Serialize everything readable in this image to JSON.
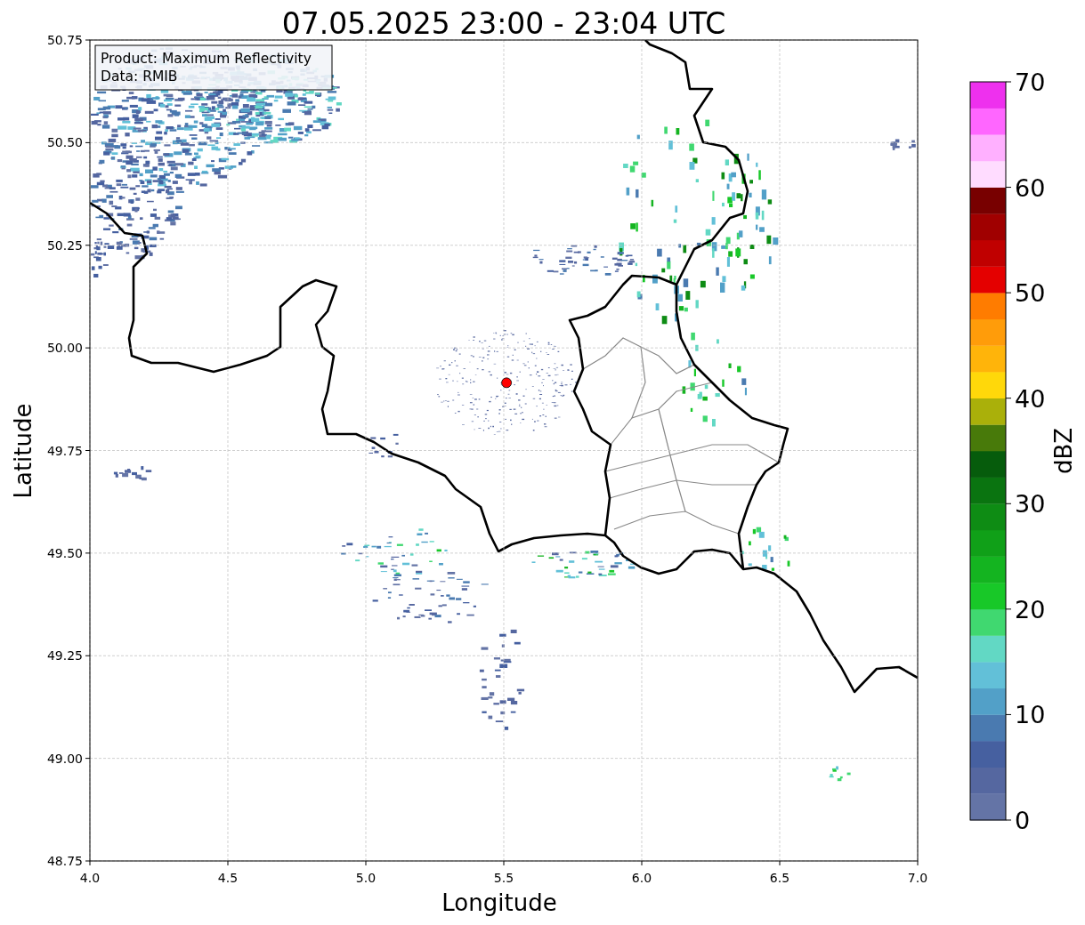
{
  "chart": {
    "chart_data": {
      "type": "scatter",
      "title": "07.05.2025 23:00 - 23:04 UTC",
      "xlabel": "Longitude",
      "ylabel": "Latitude",
      "xlim": [
        4,
        7
      ],
      "ylim": [
        48.75,
        50.75
      ],
      "xticks": [
        {
          "value": 4,
          "label": "4.0"
        },
        {
          "value": 4.5,
          "label": "4.5"
        },
        {
          "value": 5,
          "label": "5.0"
        },
        {
          "value": 5.5,
          "label": "5.5"
        },
        {
          "value": 6,
          "label": "6.0"
        },
        {
          "value": 6.5,
          "label": "6.5"
        },
        {
          "value": 7,
          "label": "7.0"
        }
      ],
      "yticks": [
        {
          "value": 48.75,
          "label": "48.75"
        },
        {
          "value": 49,
          "label": "49.00"
        },
        {
          "value": 49.25,
          "label": "49.25"
        },
        {
          "value": 49.5,
          "label": "49.50"
        },
        {
          "value": 49.75,
          "label": "49.75"
        },
        {
          "value": 50,
          "label": "50.00"
        },
        {
          "value": 50.25,
          "label": "50.25"
        },
        {
          "value": 50.5,
          "label": "50.50"
        },
        {
          "value": 50.75,
          "label": "50.75"
        }
      ],
      "grid": true,
      "x": [
        5.51
      ],
      "series": [
        {
          "color": "#ff0000",
          "values": [
            49.915
          ]
        }
      ]
    },
    "info_box": [
      "Product: Maximum Reflectivity",
      "Data: RMIB"
    ]
  },
  "colorbar": {
    "label": "dBZ",
    "ticks": [
      "70",
      "60",
      "50",
      "40",
      "30",
      "20",
      "10",
      "0"
    ],
    "bins": [
      {
        "color": "#6474a6"
      },
      {
        "color": "#5567a0"
      },
      {
        "color": "#4660a0"
      },
      {
        "color": "#4a7ab0"
      },
      {
        "color": "#52a0c8"
      },
      {
        "color": "#62c0d8"
      },
      {
        "color": "#62d8c4"
      },
      {
        "color": "#40d870"
      },
      {
        "color": "#18c828"
      },
      {
        "color": "#14b420"
      },
      {
        "color": "#10a018"
      },
      {
        "color": "#0e8c14"
      },
      {
        "color": "#0a7410"
      },
      {
        "color": "#065c0c"
      },
      {
        "color": "#487a0a"
      },
      {
        "color": "#aab00a"
      },
      {
        "color": "#ffd80a"
      },
      {
        "color": "#ffb40a"
      },
      {
        "color": "#ff9c0a"
      },
      {
        "color": "#ff7c00"
      },
      {
        "color": "#e40000"
      },
      {
        "color": "#c00000"
      },
      {
        "color": "#a00000"
      },
      {
        "color": "#780000"
      },
      {
        "color": "#ffdcff"
      },
      {
        "color": "#ffb0ff"
      },
      {
        "color": "#ff66ff"
      },
      {
        "color": "#ee30ee"
      }
    ]
  }
}
